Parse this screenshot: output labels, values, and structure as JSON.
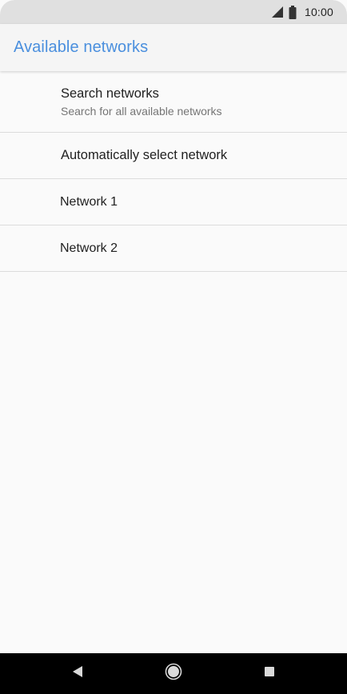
{
  "status_bar": {
    "time": "10:00",
    "icons": [
      "signal-icon",
      "battery-icon"
    ]
  },
  "app_bar": {
    "title": "Available networks",
    "title_color": "#4a8fde"
  },
  "list": {
    "search": {
      "title": "Search networks",
      "subtitle": "Search for all available networks"
    },
    "auto": {
      "title": "Automatically select network"
    },
    "networks": [
      {
        "title": "Network 1"
      },
      {
        "title": "Network 2"
      }
    ]
  },
  "nav_bar": {
    "icons": [
      "back-icon",
      "home-icon",
      "recents-icon"
    ]
  }
}
